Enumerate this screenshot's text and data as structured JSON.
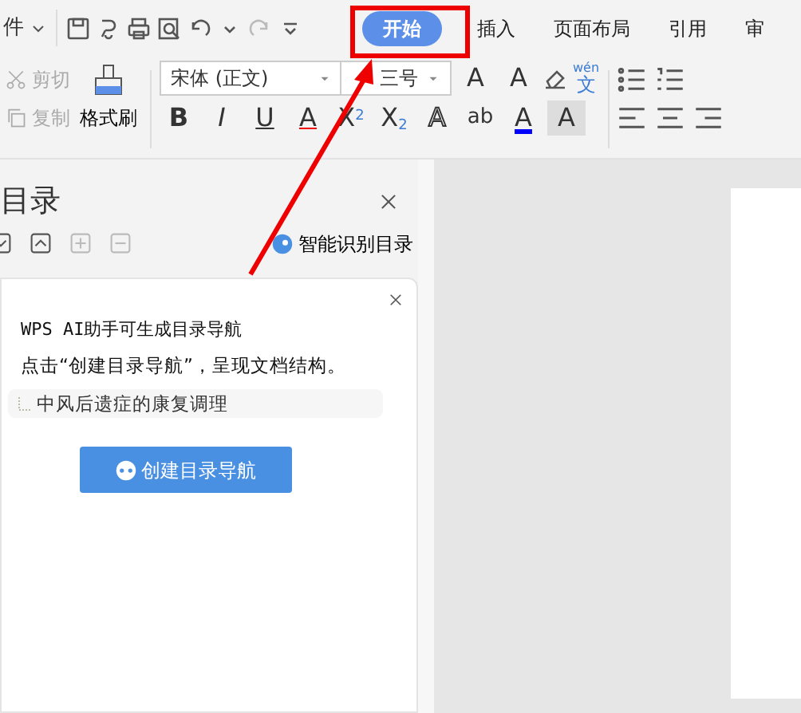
{
  "quick_access": {
    "menu_label": "件"
  },
  "tabs": [
    {
      "label": "开始",
      "selected": true
    },
    {
      "label": "插入",
      "selected": false
    },
    {
      "label": "页面布局",
      "selected": false
    },
    {
      "label": "引用",
      "selected": false
    },
    {
      "label": "审",
      "selected": false
    }
  ],
  "ribbon": {
    "clipboard": [
      {
        "kind": "cut",
        "label": "剪切",
        "disabled": true
      },
      {
        "kind": "copy",
        "label": "复制",
        "disabled": true
      }
    ],
    "format_painter": "格式刷",
    "font": {
      "value": "宋体 (正文)"
    },
    "size": {
      "value": "三号"
    },
    "size_buttons": [
      "A",
      "A"
    ],
    "pinyin": {
      "ruby": "wén",
      "char": "文"
    },
    "format_glyphs": [
      {
        "kind": "bold",
        "glyph": "B"
      },
      {
        "kind": "italic",
        "glyph": "I"
      },
      {
        "kind": "underline",
        "glyph": "U"
      },
      {
        "kind": "strike",
        "glyph": "A"
      },
      {
        "kind": "sup",
        "glyph": "X",
        "index": "2"
      },
      {
        "kind": "sub",
        "glyph": "X",
        "index": "2"
      },
      {
        "kind": "outline",
        "glyph": "A"
      },
      {
        "kind": "highlight",
        "glyph": "ab"
      },
      {
        "kind": "color",
        "glyph": "A"
      },
      {
        "kind": "shade",
        "glyph": "A"
      }
    ]
  },
  "toc_panel": {
    "title": "目录",
    "smart_label": "智能识别目录",
    "card": {
      "line_1": "WPS AI助手可生成目录导航",
      "line_2": "点击“创建目录导航”，呈现文档结构。",
      "outline_item": "中风后遗症的康复调理",
      "button": "创建目录导航"
    }
  }
}
